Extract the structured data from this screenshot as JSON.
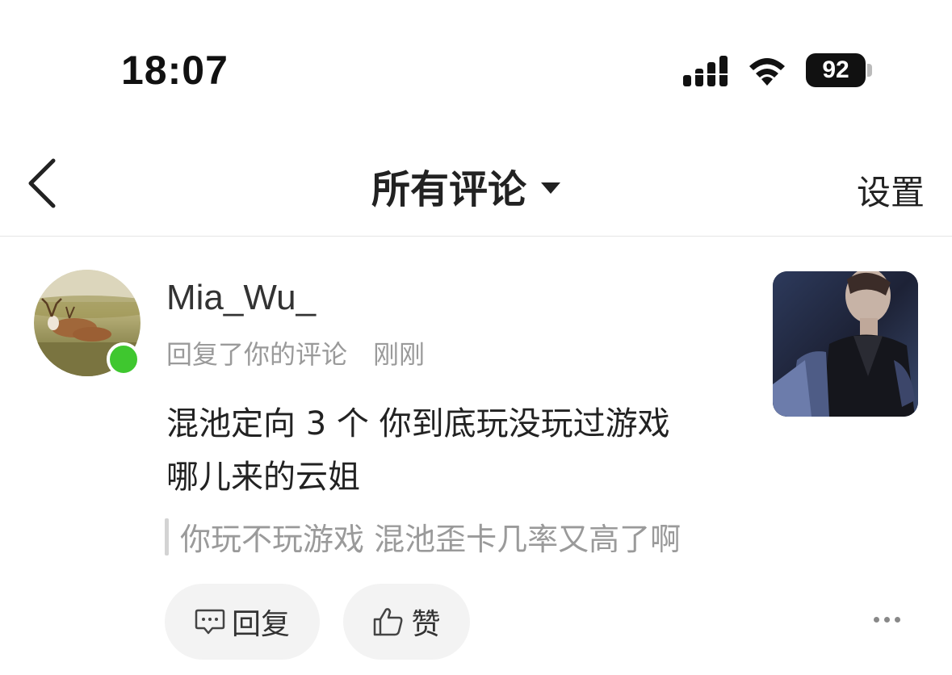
{
  "status_bar": {
    "time": "18:07",
    "battery_level": "92"
  },
  "nav": {
    "title": "所有评论",
    "settings_label": "设置"
  },
  "comment": {
    "username": "Mia_Wu_",
    "action_text": "回复了你的评论",
    "timestamp": "刚刚",
    "content_line1": "混池定向 3 个 你到底玩没玩过游戏",
    "content_line2": "哪儿来的云姐",
    "quoted_text": "你玩不玩游戏 混池歪卡几率又高了啊",
    "online_color": "#3fc72f"
  },
  "actions": {
    "reply_label": "回复",
    "like_label": "赞"
  },
  "icons": [
    "back-icon",
    "caret-down-icon",
    "signal-icon",
    "wifi-icon",
    "battery-icon",
    "comment-icon",
    "thumbs-up-icon",
    "more-icon"
  ]
}
